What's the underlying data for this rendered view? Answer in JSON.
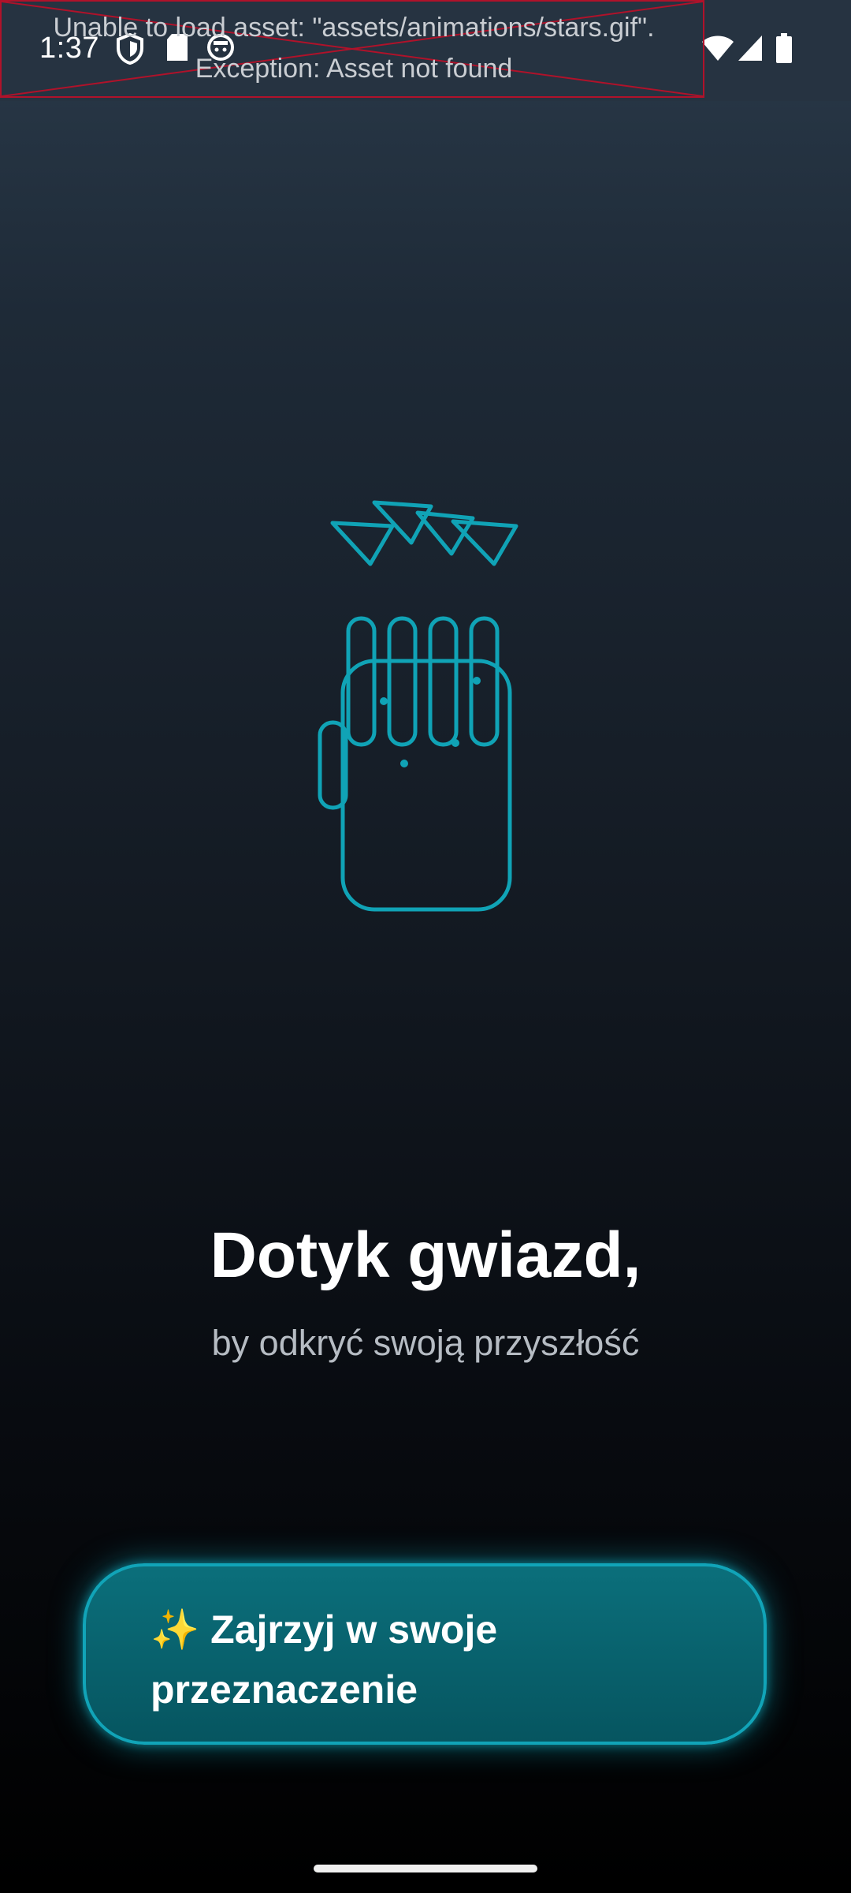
{
  "status_bar": {
    "time": "1:37",
    "icons": [
      "shield-icon",
      "sd-card-icon",
      "face-icon",
      "wifi-icon",
      "signal-icon",
      "battery-icon"
    ]
  },
  "error_overlay": {
    "line1": "Unable to load asset: \"assets/animations/stars.gif\".",
    "line2": "Exception: Asset not found",
    "border_color": "#b0122a"
  },
  "illustration": {
    "icon": "hand-with-stars-icon",
    "accent_color": "#10a3b6"
  },
  "main": {
    "title": "Dotyk gwiazd,",
    "subtitle": "by odkryć swoją przyszłość"
  },
  "cta": {
    "label": "✨ Zajrzyj w swoje przeznaczenie",
    "accent_color": "#11a4b8"
  }
}
